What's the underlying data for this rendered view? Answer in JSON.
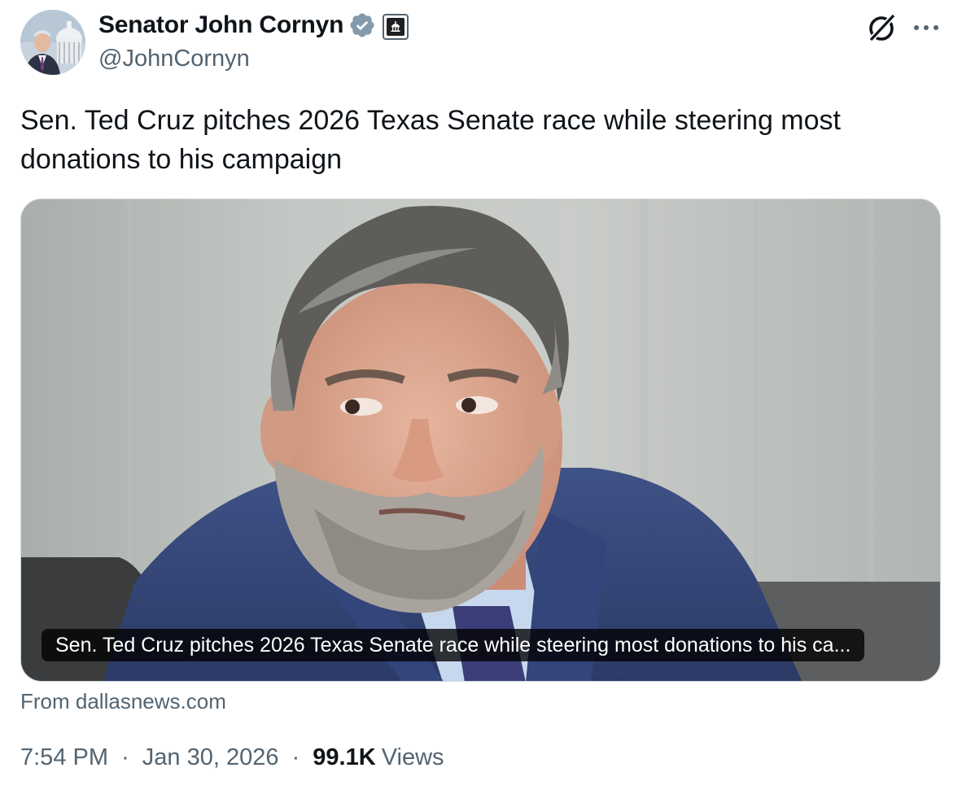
{
  "author": {
    "name": "Senator John Cornyn",
    "handle": "@JohnCornyn",
    "verified_color": "#829aab",
    "avatar_icon": "senator-portrait-capitol",
    "affiliation_badge_icon": "government-building-icon"
  },
  "header_actions": {
    "grok_icon": "grok-icon",
    "more_icon": "more-icon"
  },
  "tweet": {
    "text": "Sen. Ted Cruz pitches 2026 Texas Senate race while steering most donations to his campaign"
  },
  "link_card": {
    "image_subject": "photo-of-senator",
    "title": "Sen. Ted Cruz pitches 2026 Texas Senate race while steering most donations to his ca...",
    "source": "From dallasnews.com"
  },
  "meta": {
    "time": "7:54 PM",
    "separator": "·",
    "date": "Jan 30, 2026",
    "views_count": "99.1K",
    "views_label": "Views"
  },
  "colors": {
    "text_primary": "#0f1419",
    "text_secondary": "#536471",
    "border": "#cfd9de"
  }
}
